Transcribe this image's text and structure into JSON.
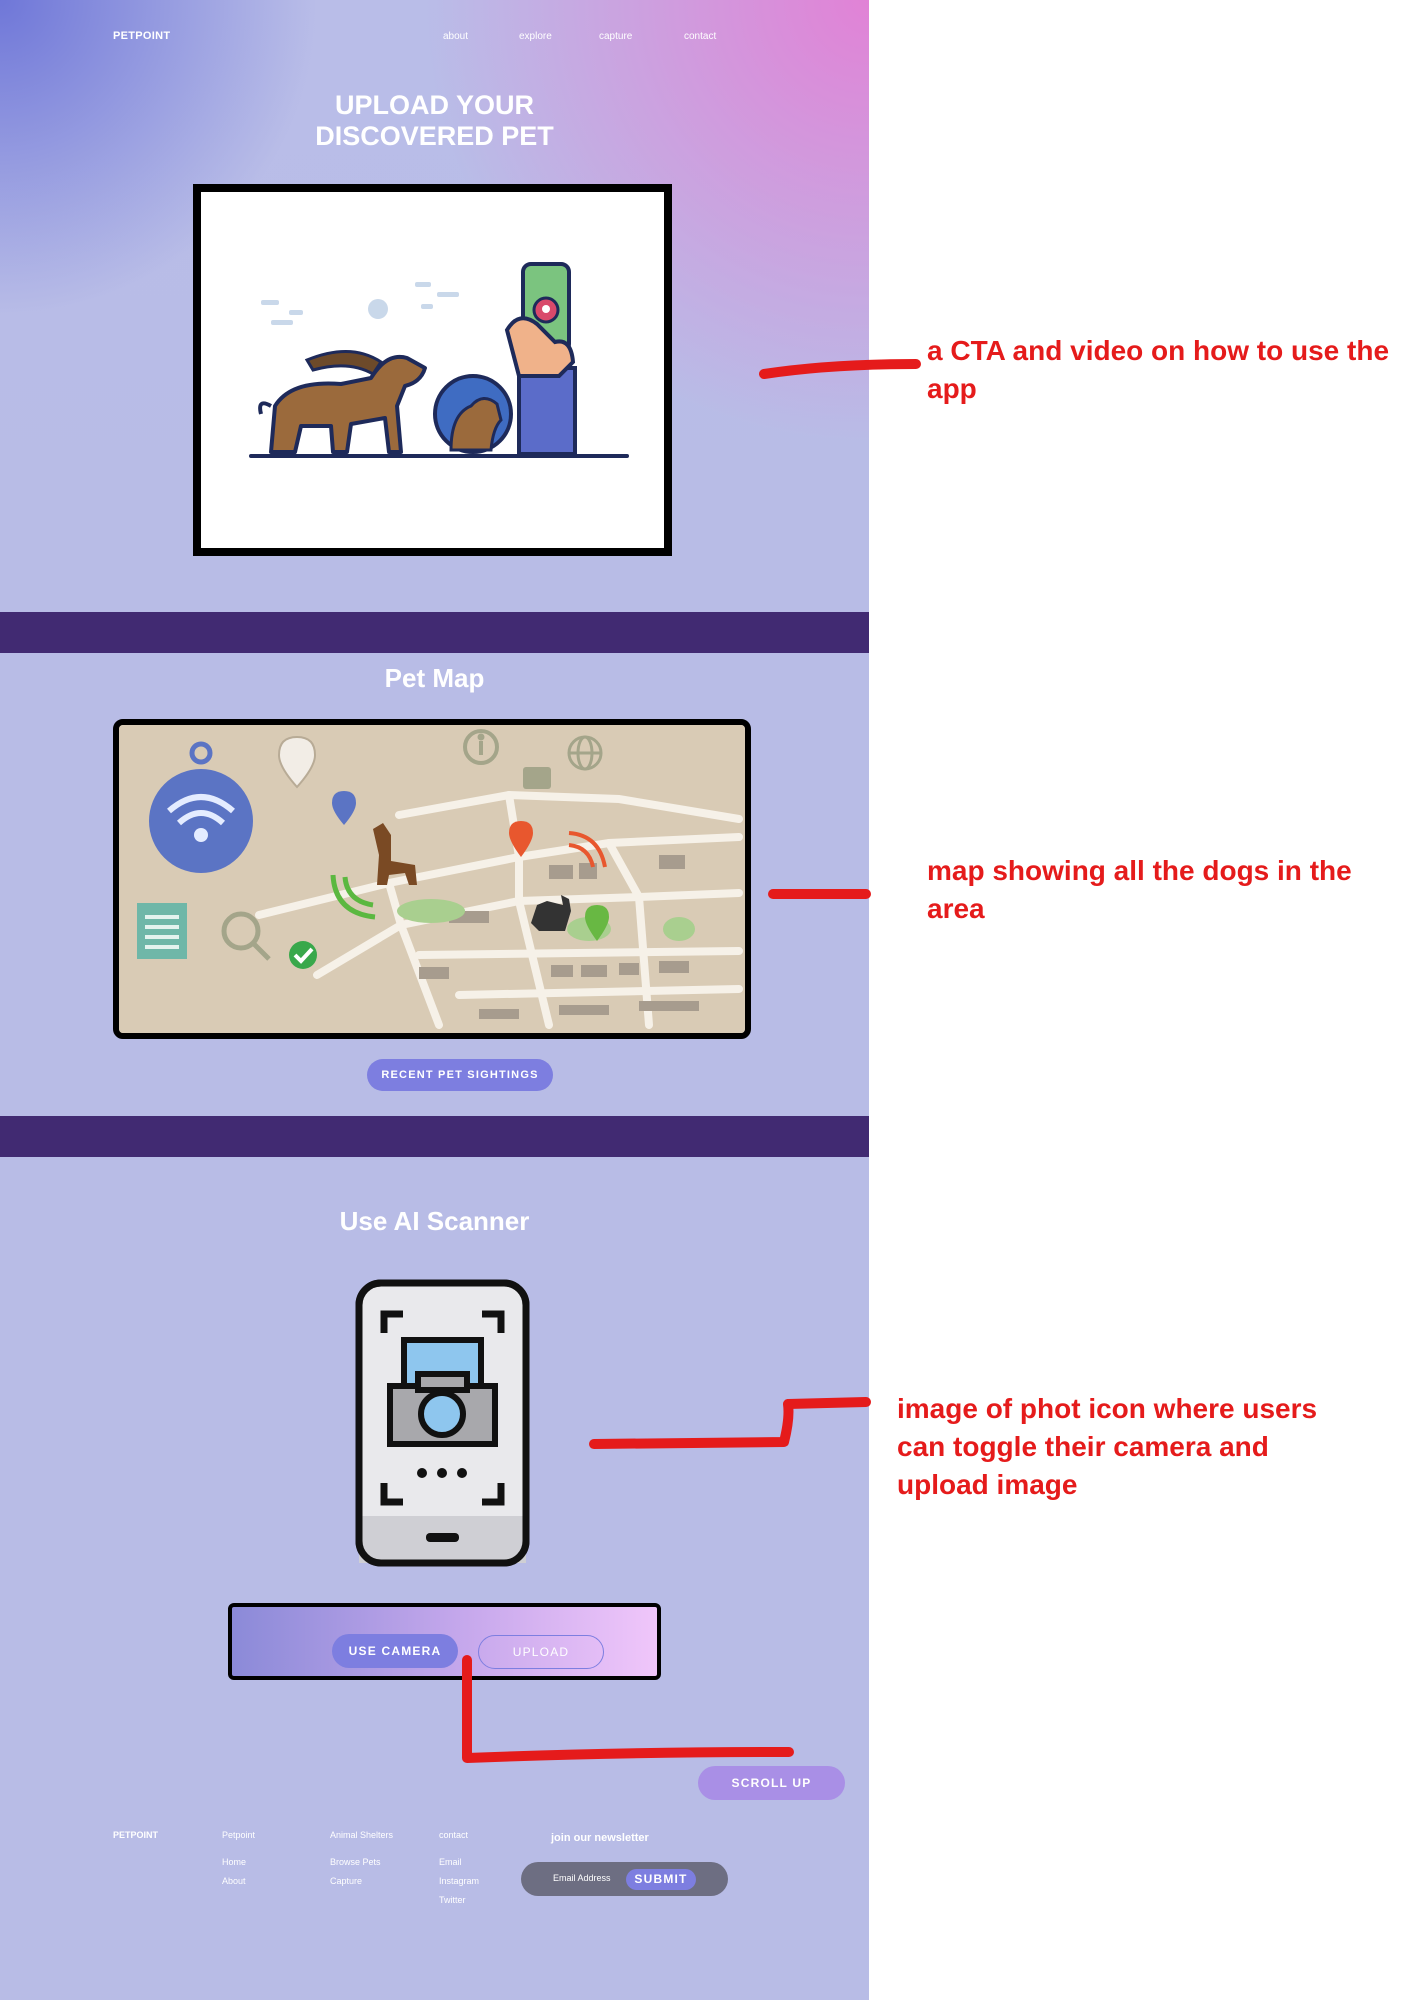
{
  "nav": {
    "brand": "PETPOINT",
    "links": [
      "about",
      "explore",
      "capture",
      "contact"
    ]
  },
  "hero": {
    "title_line1": "UPLOAD YOUR",
    "title_line2": "DISCOVERED PET"
  },
  "map_section": {
    "title": "Pet Map",
    "button": "RECENT PET SIGHTINGS"
  },
  "scanner_section": {
    "title": "Use AI Scanner",
    "camera_button": "USE CAMERA",
    "upload_button": "UPLOAD"
  },
  "scroll_up": "SCROLL UP",
  "footer": {
    "brand": "PETPOINT",
    "col1": {
      "heading": "Petpoint",
      "links": [
        "Home",
        "About"
      ]
    },
    "col2": {
      "heading": "Animal Shelters",
      "links": [
        "Browse Pets",
        "Capture"
      ]
    },
    "col3": {
      "heading": "contact",
      "links": [
        "Email",
        "Instagram",
        "Twitter"
      ]
    },
    "newsletter": {
      "heading": "join our newsletter",
      "placeholder": "Email Address",
      "submit": "SUBMIT"
    }
  },
  "annotations": {
    "a1_line1": "a CTA and video on how to use the",
    "a1_line2": "app",
    "a2_line1": "map showing all the dogs in the",
    "a2_line2": "area",
    "a3_line1": "image of phot icon where users",
    "a3_line2": "can toggle their camera and",
    "a3_line3": "upload image"
  },
  "colors": {
    "page_bg": "#b8bce6",
    "band": "#412a72",
    "pill": "#7d7ee0",
    "scroll_up": "#a98fe6",
    "annotation": "#e51b1b"
  }
}
